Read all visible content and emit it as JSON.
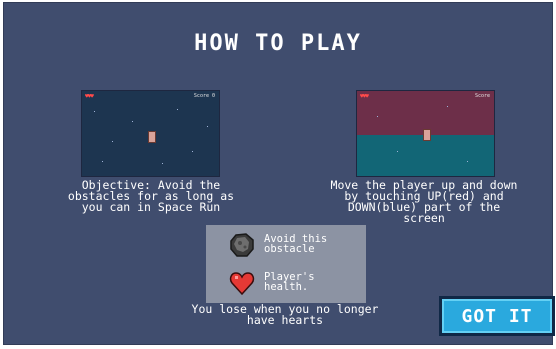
{
  "title": "HOW TO PLAY",
  "shot_left": {
    "hearts": "♥♥♥",
    "score": "Score 0"
  },
  "shot_right": {
    "hearts": "♥♥♥",
    "score": "Score"
  },
  "objective_text": "Objective: Avoid the\nobstacles for as long as\nyou can in Space Run",
  "controls_text": "Move the player up and down\nby touching UP(red) and\nDOWN(blue) part of the\nscreen",
  "legend": {
    "obstacle_label": "Avoid this\nobstacle",
    "health_label": "Player's\nhealth."
  },
  "lose_text": "You lose when you no longer\nhave hearts",
  "got_it_button": "GOT IT",
  "colors": {
    "background": "#404d6e",
    "up_zone": "#6d2f49",
    "down_zone": "#126676",
    "button": "#2aa9de",
    "heart": "#e53935"
  },
  "icons": [
    "asteroid-icon",
    "heart-icon"
  ]
}
